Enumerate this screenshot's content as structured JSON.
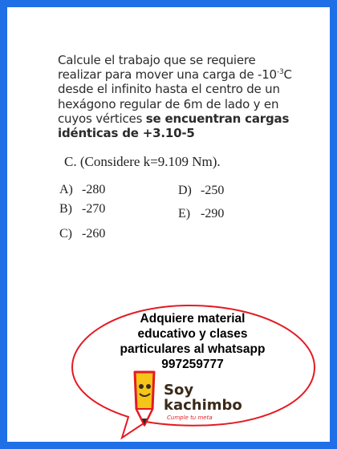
{
  "question": {
    "line1": "Calcule el trabajo que se requiere",
    "line2_prefix": "realizar para mover una carga de -10",
    "line2_sup": "-3",
    "line2_suffix": "C",
    "line3": "desde  el  infinito hasta el centro de un",
    "line4": "hexágono regular de 6m de lado y en",
    "line5_normal": "cuyos vértices  ",
    "line5_bold": "se encuentran cargas",
    "line6": "idénticas de  +3.10-5"
  },
  "consider": "C.  (Considere k=9.109 Nm).",
  "options": [
    {
      "letter": "A)",
      "value": "-280"
    },
    {
      "letter": "B)",
      "value": "-270"
    },
    {
      "letter": "C)",
      "value": "-260"
    },
    {
      "letter": "D)",
      "value": "-250"
    },
    {
      "letter": "E)",
      "value": "-290"
    }
  ],
  "promo": {
    "line1": "Adquiere material",
    "line2": "educativo y clases",
    "line3": "particulares al whatsapp",
    "line4": "997259777"
  },
  "logo": {
    "word1": "Soy",
    "word2": "kachimbo",
    "slogan": "Cumple tu meta"
  },
  "colors": {
    "frame": "#1f6fe6",
    "bubble_border": "#e31b23",
    "logo_red": "#e31b23",
    "logo_yellow": "#f5c518"
  }
}
